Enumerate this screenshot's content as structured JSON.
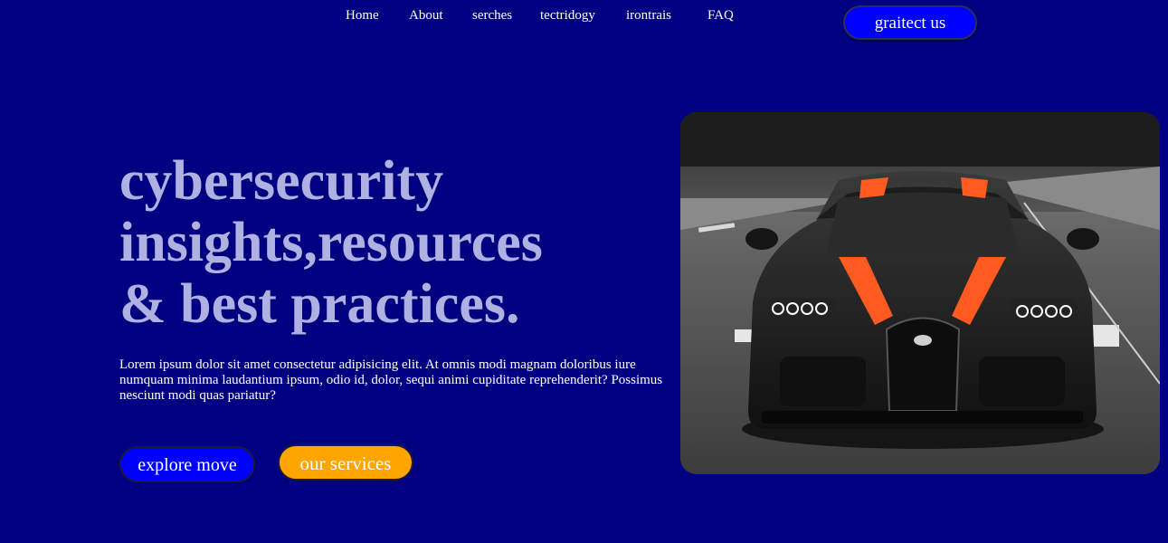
{
  "nav": {
    "items": [
      {
        "label": "Home"
      },
      {
        "label": "About"
      },
      {
        "label": "serches"
      },
      {
        "label": "tectridogy"
      },
      {
        "label": "irontrais"
      },
      {
        "label": "FAQ"
      }
    ],
    "contact_label": "graitect us"
  },
  "hero": {
    "title_lines": [
      "cybersecurity",
      "insights,resources",
      "& best practices."
    ],
    "description": "Lorem ipsum dolor sit amet consectetur adipisicing elit. At omnis modi magnam doloribus iure numquam minima laudantium ipsum, odio id, dolor, sequi animi cupiditate reprehenderit? Possimus nesciunt modi quas pariatur?",
    "explore_label": "explore move",
    "services_label": "our services",
    "image_icon": "sports-car-photo"
  },
  "colors": {
    "background": "#000080",
    "title": "#aeb1e2",
    "primary_button": "#0000ff",
    "secondary_button": "#ffa500",
    "text": "#ffffff"
  }
}
